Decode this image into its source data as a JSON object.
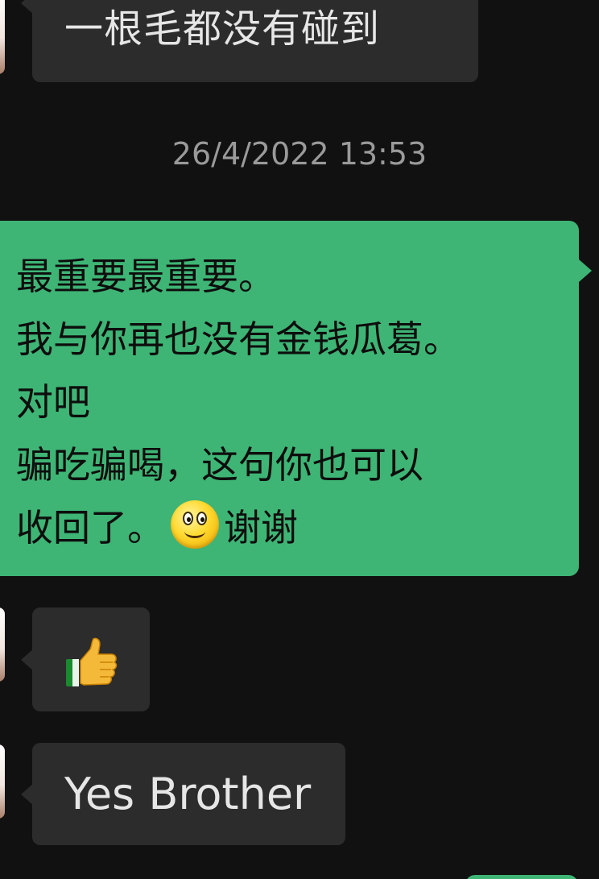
{
  "messages": {
    "top": "一根毛都没有碰到",
    "timestamp": "26/4/2022 13:53",
    "green_lines": [
      "最重要最重要。",
      "我与你再也没有金钱瓜葛。",
      "对吧",
      "骗吃骗喝，这句你也可以",
      "收回了。"
    ],
    "green_tail": "谢谢",
    "thumb_emoji": "thumbs-up",
    "yes": "Yes Brother"
  },
  "colors": {
    "background": "#111111",
    "incoming_bubble": "#2c2c2c",
    "outgoing_bubble": "#3eb575",
    "timestamp_text": "#9a9a9a"
  },
  "icons": {
    "smiley": "smiley-emoji",
    "thumbs_up": "thumbs-up-emoji"
  }
}
